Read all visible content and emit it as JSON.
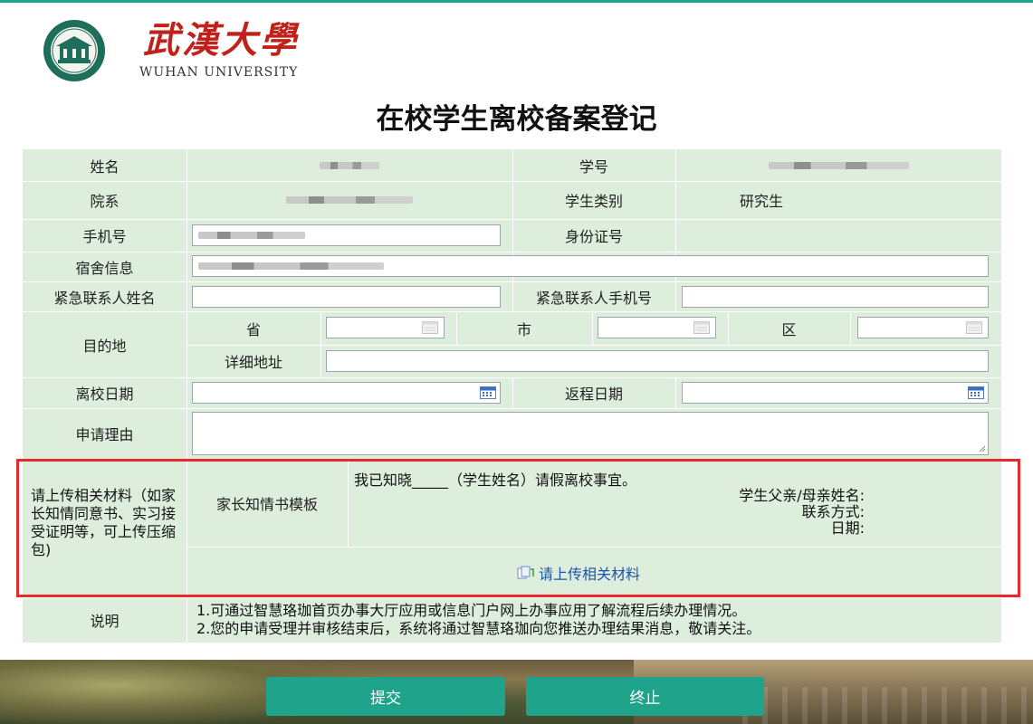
{
  "brand": {
    "name_cn": "武漢大學",
    "name_en": "WUHAN UNIVERSITY",
    "seal_icon": "university-seal-icon",
    "red": "#c0211b"
  },
  "page_title": "在校学生离校备案登记",
  "form": {
    "name_label": "姓名",
    "student_no_label": "学号",
    "dept_label": "院系",
    "student_type_label": "学生类别",
    "student_type_value": "研究生",
    "phone_label": "手机号",
    "id_label": "身份证号",
    "dorm_label": "宿舍信息",
    "emergency_name_label": "紧急联系人姓名",
    "emergency_phone_label": "紧急联系人手机号",
    "destination_label": "目的地",
    "province_label": "省",
    "city_label": "市",
    "district_label": "区",
    "address_label": "详细地址",
    "leave_date_label": "离校日期",
    "return_date_label": "返程日期",
    "reason_label": "申请理由",
    "upload_section_label": "请上传相关材料（如家长知情同意书、实习接受证明等，可上传压缩包)",
    "template_label": "家长知情书模板",
    "template_statement": "我已知晓_____（学生姓名）请假离校事宜。",
    "parent_name_label": "学生父亲/母亲姓名:",
    "contact_label": "联系方式:",
    "date_label": "日期:",
    "upload_link": "请上传相关材料",
    "notes_label": "说明",
    "note_1": "1.可通过智慧珞珈首页办事大厅应用或信息门户网上办事应用了解流程后续办理情况。",
    "note_2": "2.您的申请受理并审核结束后，系统将通过智慧珞珈向您推送办理结果消息，敬请关注。"
  },
  "buttons": {
    "submit": "提交",
    "stop": "终止"
  },
  "colors": {
    "accent": "#1fa38a",
    "form_bg": "#ddeedd",
    "highlight_border": "#e8282c",
    "link": "#1a55a8"
  },
  "icons": [
    "calendar-icon",
    "paperclip-icon",
    "resize-grip-icon"
  ]
}
